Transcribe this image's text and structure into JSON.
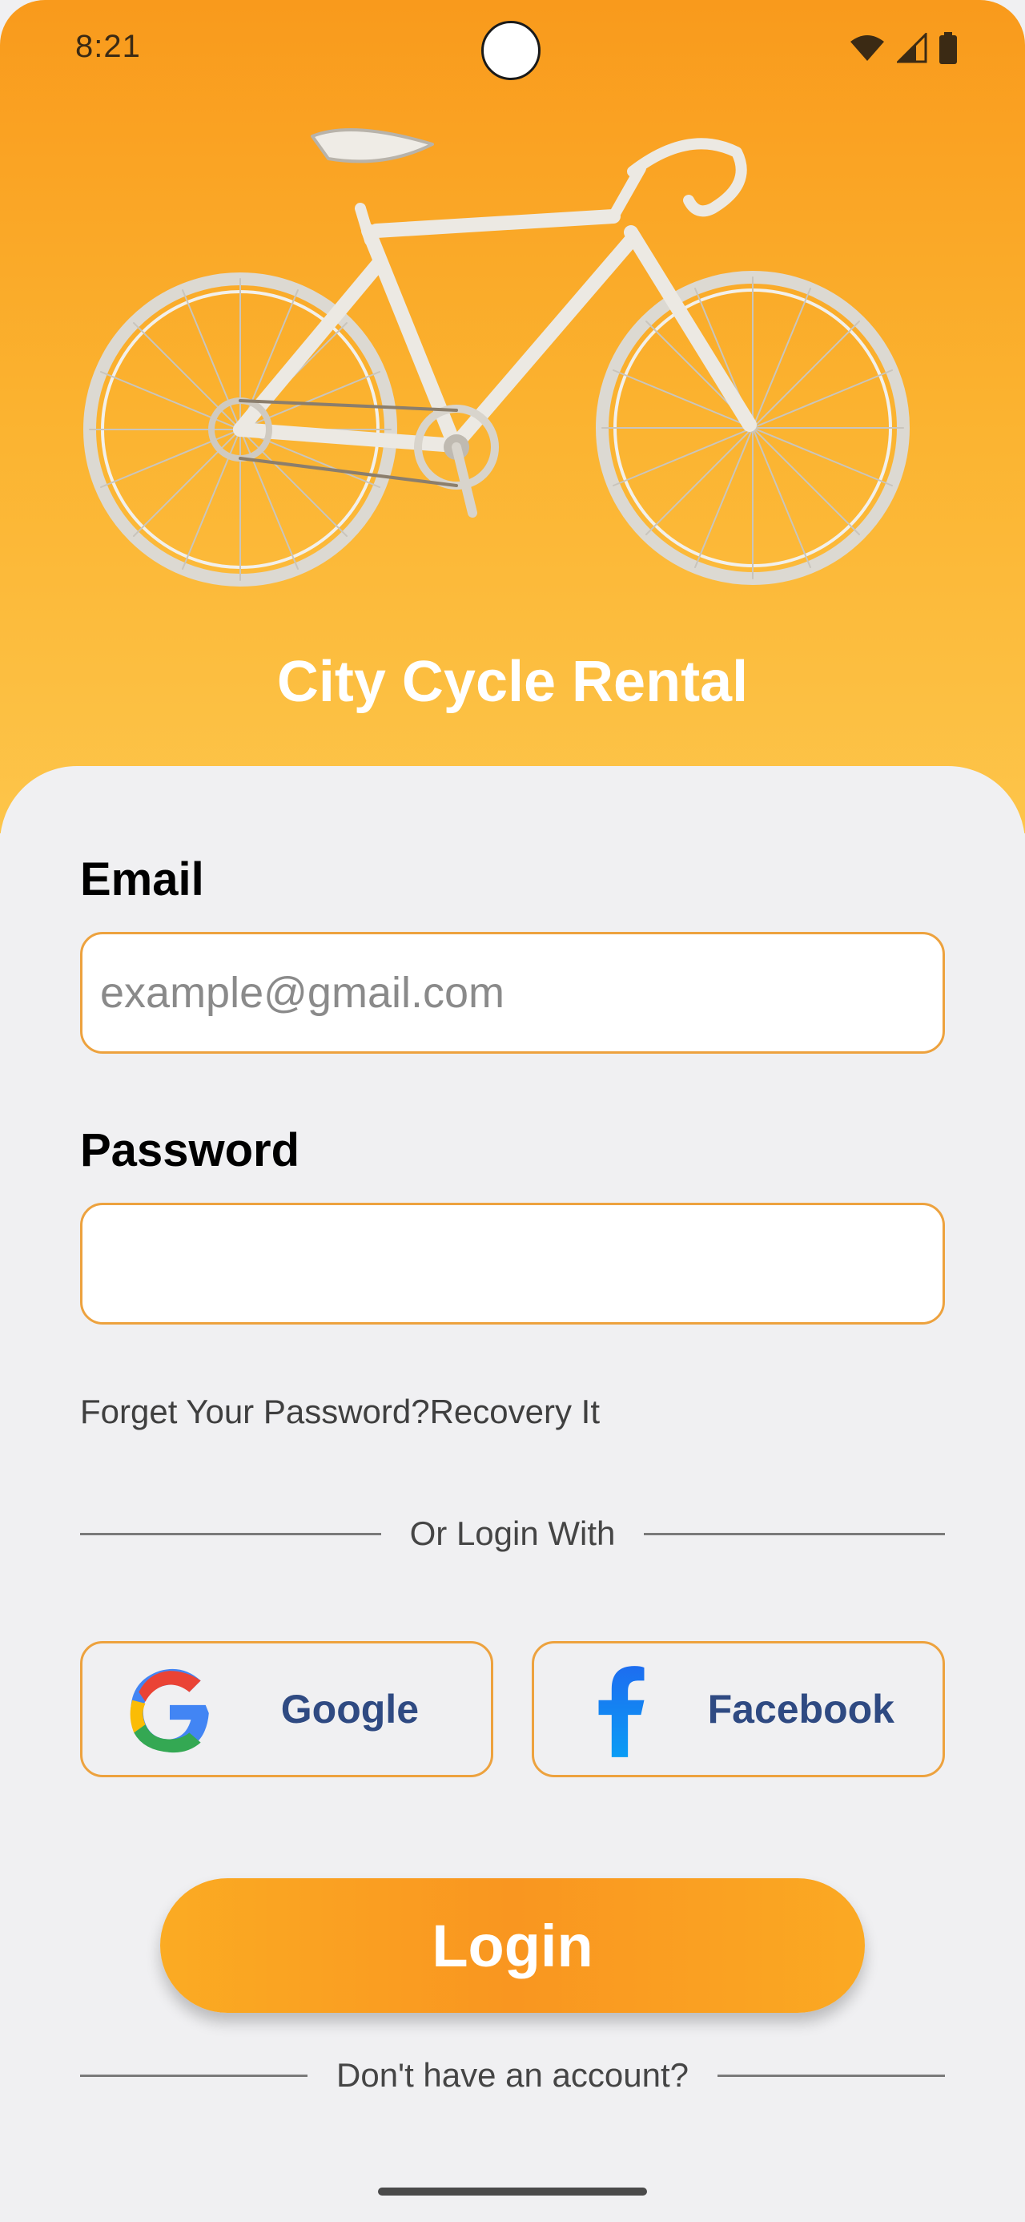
{
  "status_bar": {
    "time": "8:21",
    "icons": [
      "wifi-icon",
      "cell-signal-icon",
      "battery-icon"
    ]
  },
  "header": {
    "image": "bicycle-illustration",
    "app_title": "City Cycle Rental"
  },
  "form": {
    "email": {
      "label": "Email",
      "value": "",
      "placeholder": "example@gmail.com"
    },
    "password": {
      "label": "Password",
      "value": "",
      "placeholder": ""
    },
    "recovery_text": "Forget Your Password?Recovery It"
  },
  "social": {
    "divider_text": "Or Login With",
    "google": {
      "label": "Google",
      "icon": "google-icon"
    },
    "facebook": {
      "label": "Facebook",
      "icon": "facebook-icon"
    }
  },
  "login_button": {
    "label": "Login"
  },
  "footer": {
    "signup_text": "Don't have an account?"
  },
  "colors": {
    "accent": "#f99a1c",
    "field_border": "#eda23e",
    "social_text": "#2f4a82",
    "background": "#f0f0f2"
  }
}
